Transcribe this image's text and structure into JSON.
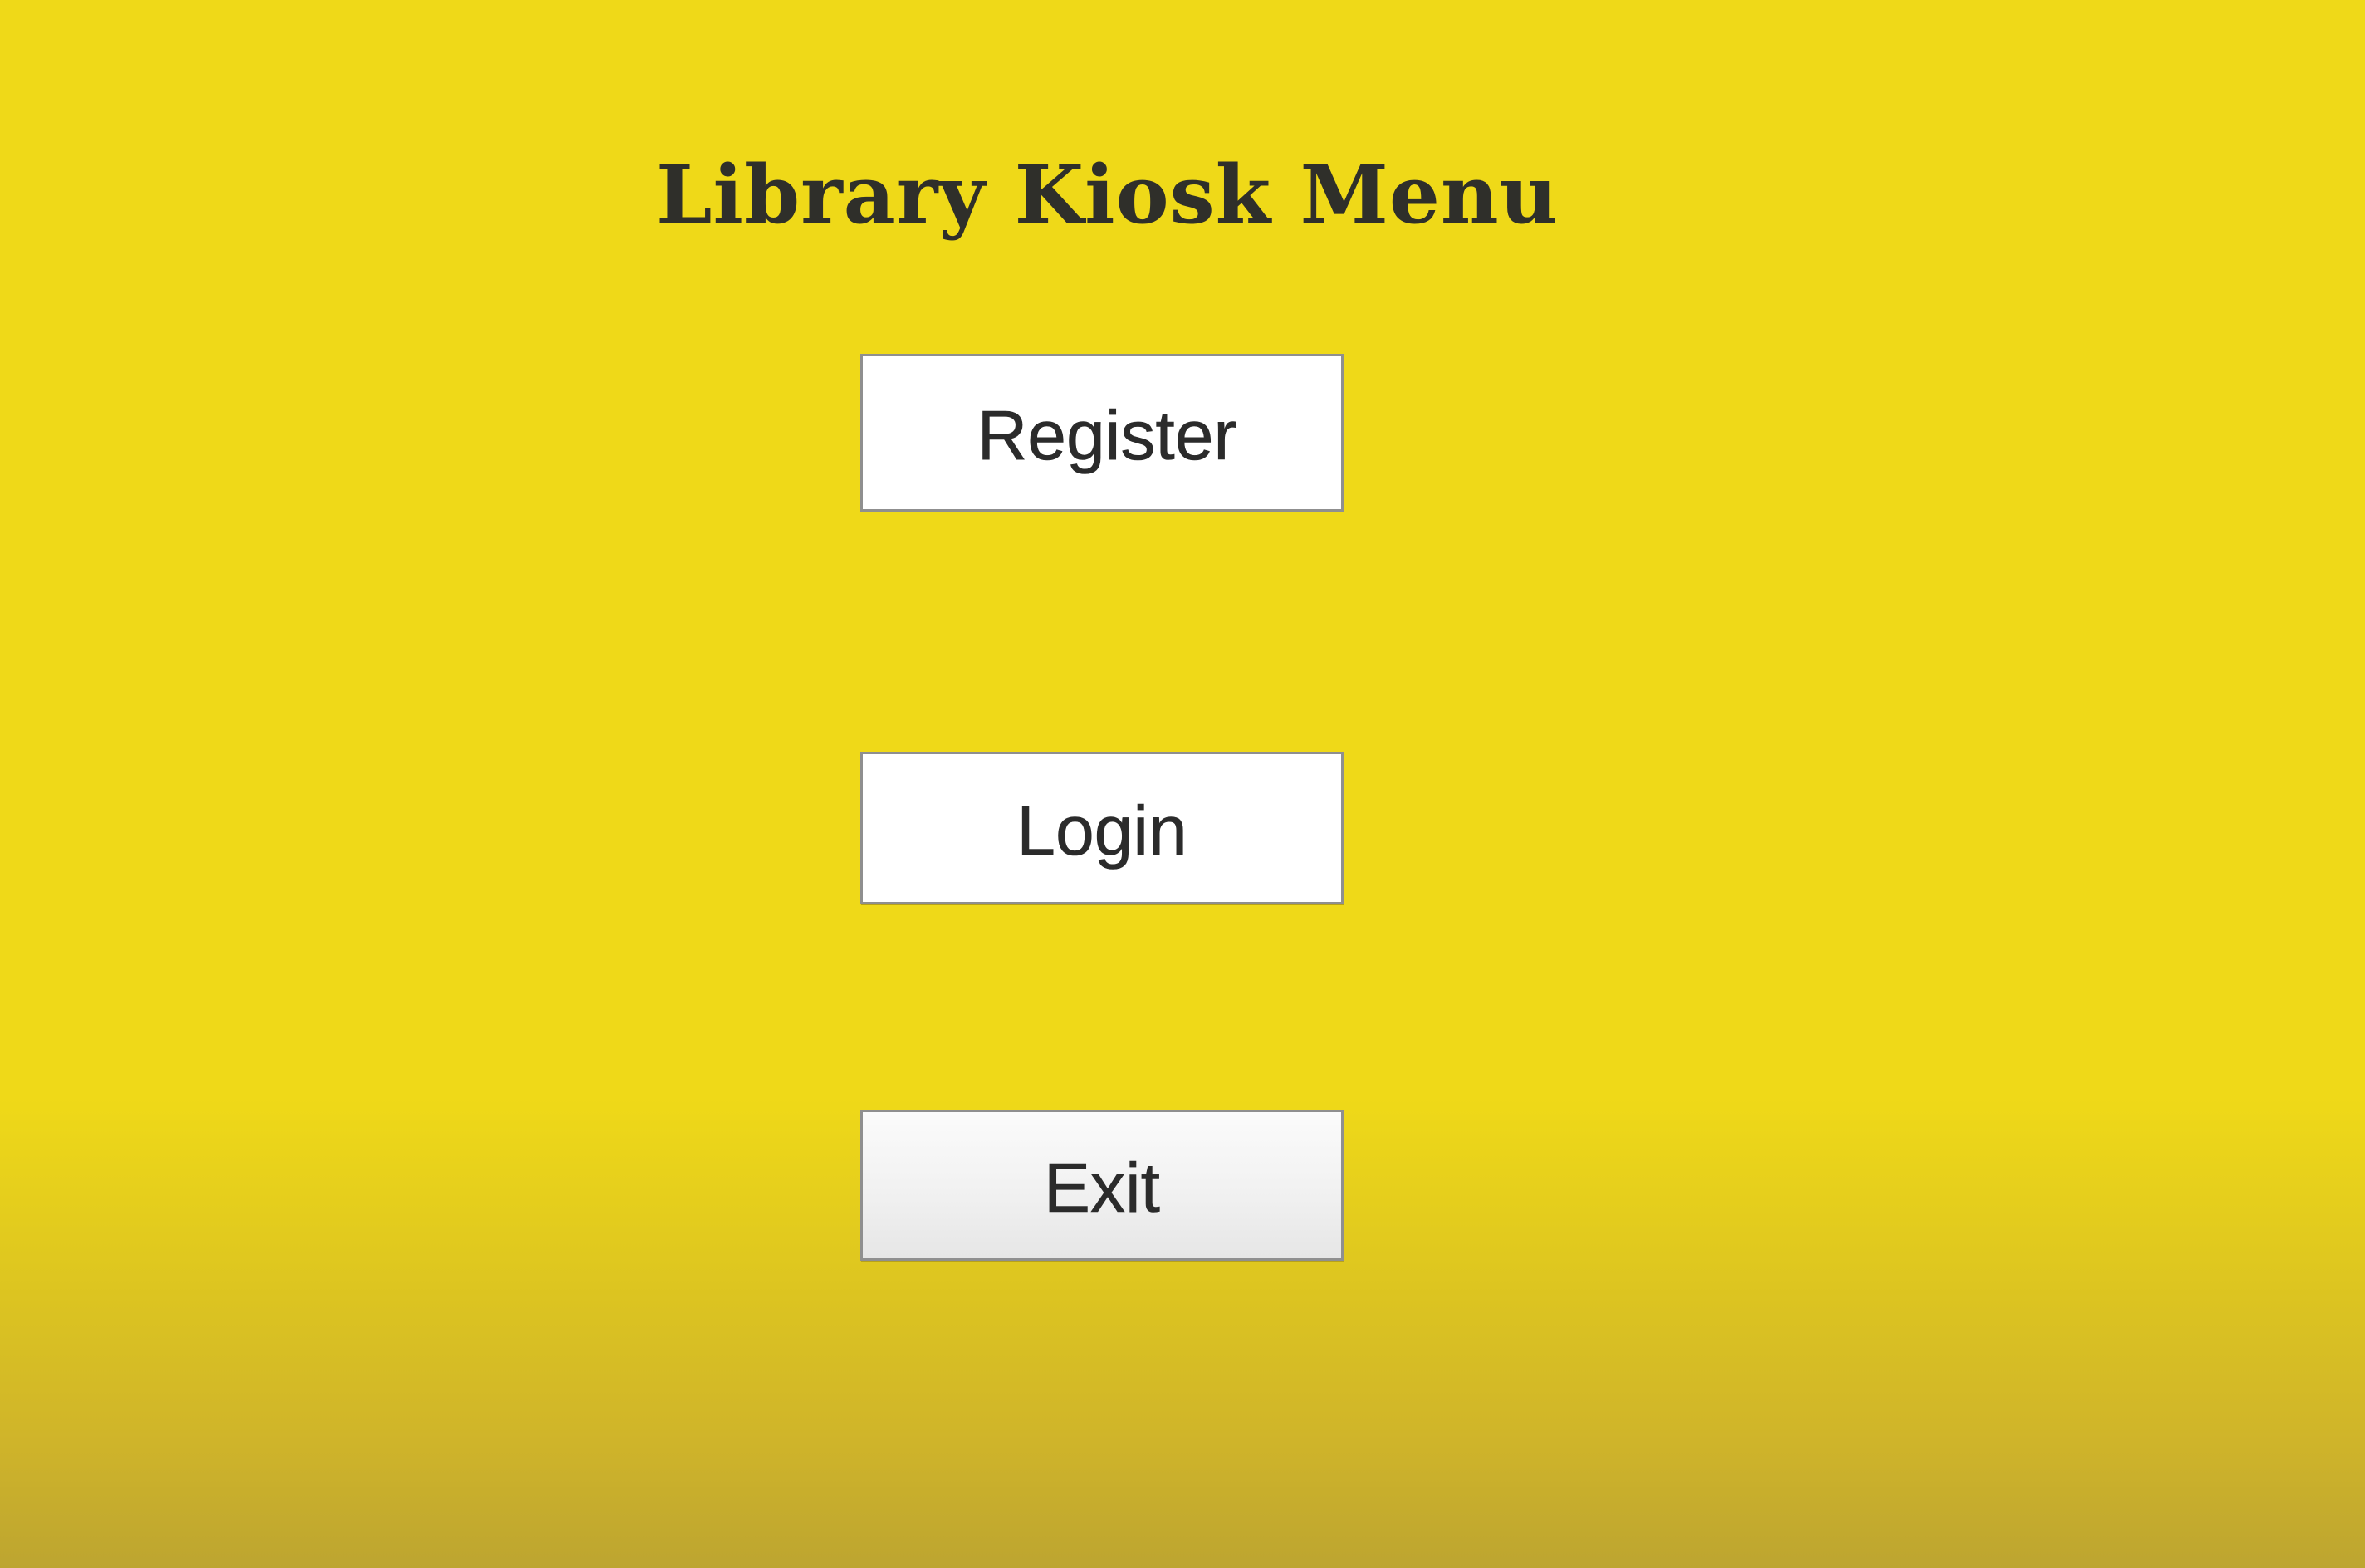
{
  "app": {
    "title": "Library Kiosk Menu"
  },
  "menu": {
    "register_label": "Register",
    "login_label": "Login",
    "exit_label": "Exit"
  },
  "colors": {
    "background": "#efd918",
    "button_background": "#ffffff",
    "text": "#2f2f2a"
  }
}
